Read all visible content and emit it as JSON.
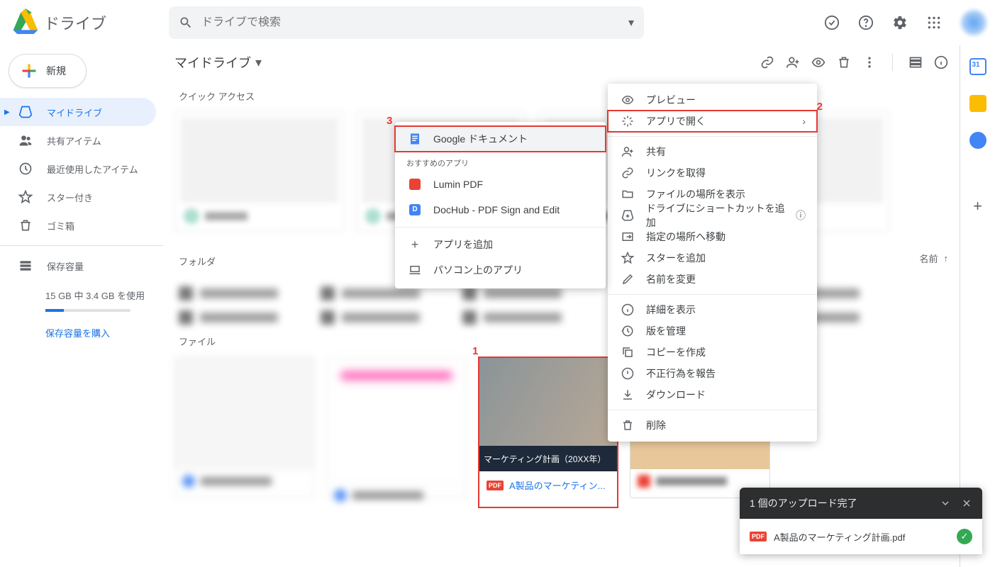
{
  "app_name": "ドライブ",
  "search": {
    "placeholder": "ドライブで検索"
  },
  "sidebar": {
    "new_label": "新規",
    "items": [
      {
        "label": "マイドライブ"
      },
      {
        "label": "共有アイテム"
      },
      {
        "label": "最近使用したアイテム"
      },
      {
        "label": "スター付き"
      },
      {
        "label": "ゴミ箱"
      }
    ],
    "storage_label": "保存容量",
    "storage_text": "15 GB 中 3.4 GB を使用",
    "buy_label": "保存容量を購入"
  },
  "toolbar": {
    "breadcrumb": "マイドライブ"
  },
  "sections": {
    "quick": "クイック アクセス",
    "folders": "フォルダ",
    "files": "ファイル",
    "sort_label": "名前"
  },
  "selected_file": {
    "banner": "マーケティング計画（20XX年）",
    "filename": "A製品のマーケティン..."
  },
  "context_menu": {
    "preview": "プレビュー",
    "open_with": "アプリで開く",
    "share": "共有",
    "get_link": "リンクを取得",
    "show_location": "ファイルの場所を表示",
    "add_shortcut": "ドライブにショートカットを追加",
    "move_to": "指定の場所へ移動",
    "add_star": "スターを追加",
    "rename": "名前を変更",
    "details": "詳細を表示",
    "versions": "版を管理",
    "make_copy": "コピーを作成",
    "report": "不正行為を報告",
    "download": "ダウンロード",
    "remove": "削除"
  },
  "submenu": {
    "google_docs": "Google ドキュメント",
    "recommended": "おすすめのアプリ",
    "lumin": "Lumin PDF",
    "dochub": "DocHub - PDF Sign and Edit",
    "add_app": "アプリを追加",
    "desktop_apps": "パソコン上のアプリ"
  },
  "uploader": {
    "title": "1 個のアップロード完了",
    "file": "A製品のマーケティング計画.pdf"
  },
  "annotations": {
    "a1": "1",
    "a2": "2",
    "a3": "3"
  }
}
